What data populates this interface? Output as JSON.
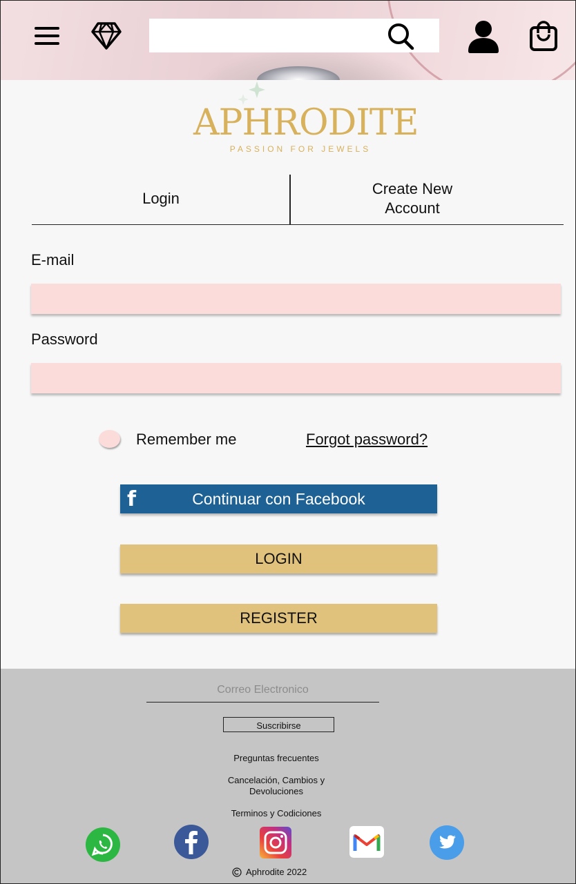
{
  "header": {
    "menu_icon": "hamburger-menu-icon",
    "brand_icon": "diamond-icon",
    "search": {
      "value": "",
      "placeholder": ""
    },
    "search_icon": "search-icon",
    "account_icon": "user-icon",
    "cart_icon": "shopping-bag-icon"
  },
  "logo": {
    "name": "APHRODITE",
    "tagline": "PASSION FOR JEWELS"
  },
  "tabs": {
    "login": "Login",
    "create_line1": "Create New",
    "create_line2": "Account"
  },
  "form": {
    "email_label": "E-mail",
    "email_value": "",
    "password_label": "Password",
    "password_value": "",
    "remember_label": "Remember me",
    "forgot_label": "Forgot password?"
  },
  "buttons": {
    "facebook": "Continuar con Facebook",
    "login": "LOGIN",
    "register": "REGISTER"
  },
  "footer": {
    "newsletter_placeholder": "Correo Electronico",
    "subscribe": "Suscribirse",
    "links": {
      "faq": "Preguntas frecuentes",
      "cancel_line1": "Cancelación, Cambios y",
      "cancel_line2": "Devoluciones",
      "terms": "Terminos y Codiciones"
    },
    "social": [
      "whatsapp-icon",
      "facebook-icon",
      "instagram-icon",
      "gmail-icon",
      "twitter-icon"
    ],
    "copyright": "Aphrodite 2022"
  },
  "colors": {
    "gold": "#e0c27c",
    "logo_gold": "#d7b15c",
    "field_pink": "#fbdcda",
    "facebook_blue": "#1e6194",
    "footer_gray": "#c5c5c5"
  }
}
